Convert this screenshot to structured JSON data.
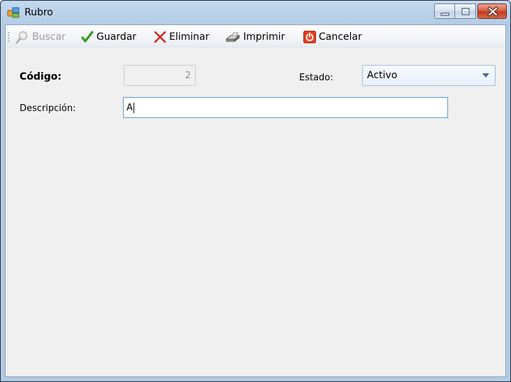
{
  "window": {
    "title": "Rubro",
    "icon": "form-window-icon",
    "controls": [
      "minimize-icon",
      "maximize-icon",
      "close-icon"
    ]
  },
  "toolbar": {
    "buscar_label": "Buscar",
    "guardar_label": "Guardar",
    "eliminar_label": "Eliminar",
    "imprimir_label": "Imprimir",
    "cancelar_label": "Cancelar"
  },
  "form": {
    "codigo_label": "Código:",
    "codigo_value": "2",
    "estado_label": "Estado:",
    "estado_value": "Activo",
    "descripcion_label": "Descripción:",
    "descripcion_value": "A"
  },
  "colors": {
    "check": "#2e9b1c",
    "delete": "#d3271c",
    "cancel": "#e8401e",
    "titlebar": "#b9cfe6"
  }
}
